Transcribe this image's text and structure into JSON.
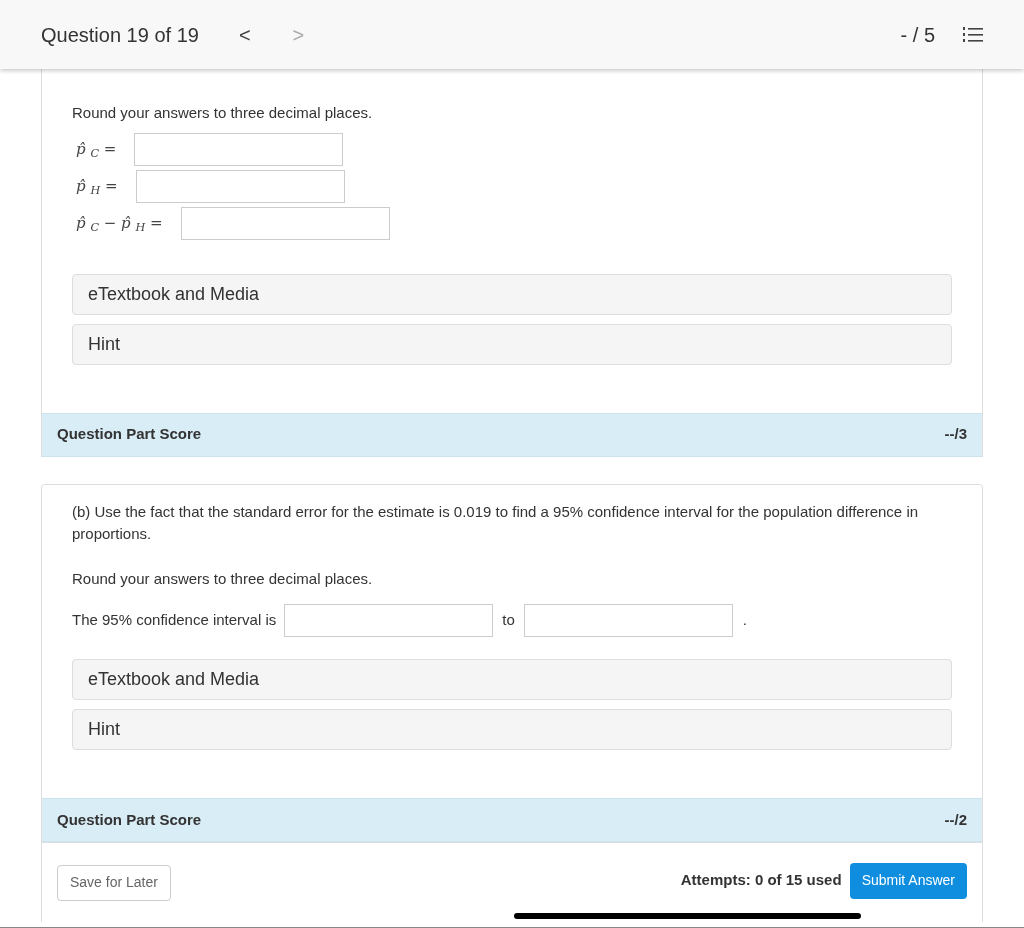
{
  "header": {
    "title": "Question 19 of 19",
    "prev": "<",
    "next": ">",
    "score": "- / 5"
  },
  "part_a": {
    "instruction": "Round your answers to three decimal places.",
    "fields": [
      {
        "label": "p̂ $_{C}$ ="
      },
      {
        "label": "p̂ $_{H}$ ="
      },
      {
        "label": "p̂ $_{C}$ − p̂ $_{H}$ ="
      }
    ],
    "resources": [
      "eTextbook and Media",
      "Hint"
    ],
    "score_label": "Question Part Score",
    "score": "--/3"
  },
  "part_b": {
    "question": "(b) Use the fact that the standard error for the estimate is 0.019 to find a 95% confidence interval for the population difference in proportions.",
    "instruction": "Round your answers to three decimal places.",
    "interval_label": "The 95% confidence interval is",
    "to": "to",
    "end": ".",
    "resources": [
      "eTextbook and Media",
      "Hint"
    ],
    "score_label": "Question Part Score",
    "score": "--/2"
  },
  "footer": {
    "save": "Save for Later",
    "attempts": "Attempts: 0 of 15 used",
    "submit": "Submit Answer"
  }
}
